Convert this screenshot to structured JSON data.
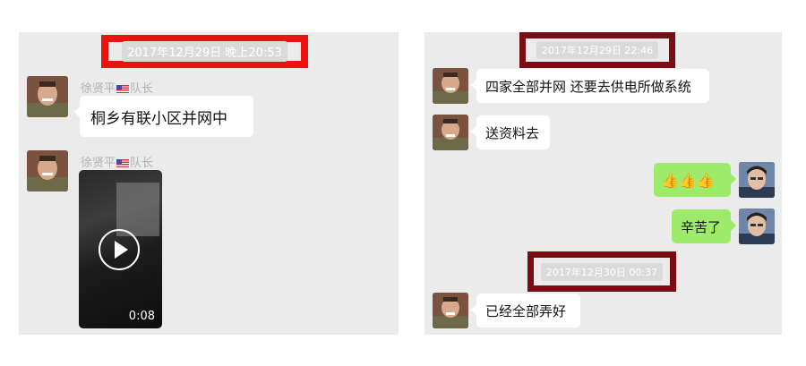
{
  "left": {
    "timestamp": "2017年12月29日 晚上20:53",
    "messages": [
      {
        "sender": "徐贤平",
        "title": "队长",
        "text": "桐乡有联小区并网中"
      },
      {
        "sender": "徐贤平",
        "title": "队长",
        "video_duration": "0:08"
      }
    ]
  },
  "right": {
    "timestamp1": "2017年12月29日 22:46",
    "msg1": "四家全部并网 还要去供电所做系统",
    "msg2": "送资料去",
    "msg3": "👍👍👍",
    "msg4": "辛苦了",
    "timestamp2": "2017年12月30日 00:37",
    "msg5": "已经全部弄好"
  },
  "colors": {
    "highlight_red": "#ee1111",
    "highlight_darkred": "#7a0c14",
    "chat_background": "#ebebeb",
    "bubble_green": "#9eea6a"
  }
}
